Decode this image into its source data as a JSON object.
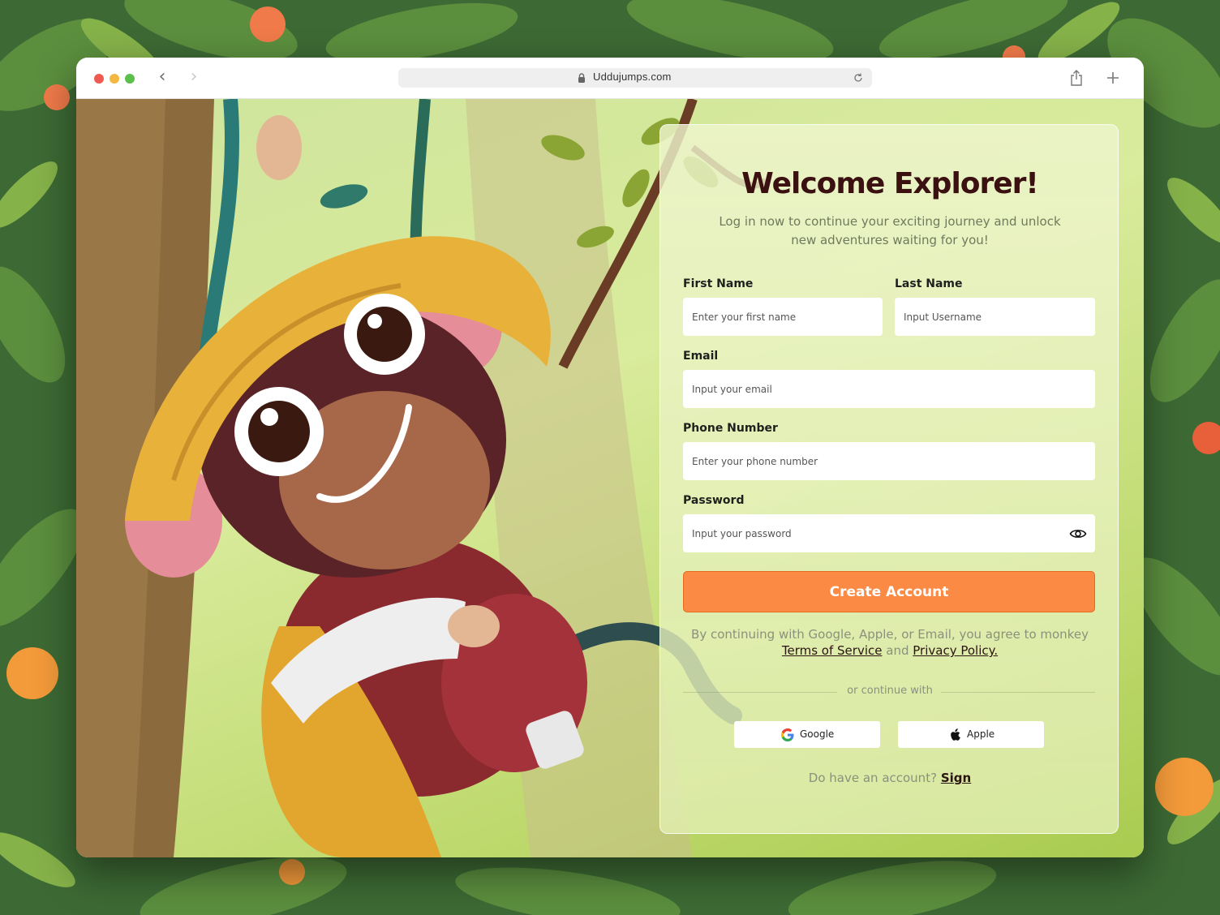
{
  "browser": {
    "url": "Uddujumps.com",
    "icons": [
      "back-icon",
      "forward-icon",
      "lock-icon",
      "reload-icon",
      "share-icon",
      "new-tab-icon"
    ]
  },
  "form": {
    "title": "Welcome Explorer!",
    "subtitle": "Log in now to continue your exciting journey and unlock new adventures waiting for you!",
    "first_name": {
      "label": "First Name",
      "placeholder": "Enter your first name"
    },
    "last_name": {
      "label": "Last Name",
      "placeholder": "Input Username"
    },
    "email": {
      "label": "Email",
      "placeholder": "Input your email"
    },
    "phone": {
      "label": "Phone Number",
      "placeholder": "Enter your phone number"
    },
    "password": {
      "label": "Password",
      "placeholder": "Input your password"
    },
    "submit_label": "Create Account",
    "consent": {
      "prefix": "By continuing with Google, Apple, or Email, you agree to monkey",
      "terms": "Terms of Service",
      "and": "and",
      "privacy": "Privacy Policy."
    },
    "divider": "or continue with",
    "google_label": "Google",
    "apple_label": "Apple",
    "signin": {
      "prompt": "Do have an account?",
      "link": "Sign"
    }
  },
  "colors": {
    "accent": "#fa8a44",
    "title": "#3a1010",
    "muted": "#8b917c"
  }
}
